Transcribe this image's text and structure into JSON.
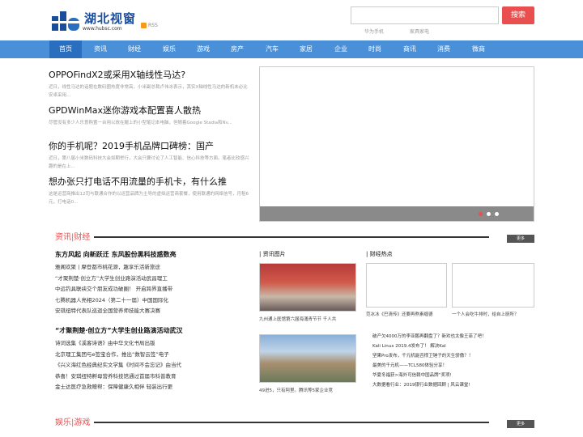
{
  "header": {
    "logo_text": "湖北视窗",
    "logo_url": "www.hubsc.com",
    "rss_label": "RSS",
    "search_placeholder": "",
    "search_button": "搜索",
    "hotwords": [
      "华为手机",
      "家具家电"
    ]
  },
  "nav": {
    "items": [
      "首页",
      "资讯",
      "财经",
      "娱乐",
      "游戏",
      "房产",
      "汽车",
      "家居",
      "企业",
      "时尚",
      "商讯",
      "消费",
      "微商"
    ],
    "active_index": 0
  },
  "headlines": [
    {
      "title": "OPPOFindX2或采用X轴线性马达?",
      "desc": "近日，线性马达的话题在数码圈热度非常高，小米副总裁卢伟冰表示，其实X轴线性马达的新机未必比安卓采用..."
    },
    {
      "title": "GPDWinMax迷你游戏本配置喜人散热",
      "desc": "尽管没有多少人乐意购置一台用以放在腿上的小型笔记本电脑，但随着Google Stadia和Nv..."
    },
    {
      "title": "你的手机呢？2019手机品牌口碑榜：国产",
      "desc": "近日，第八届小米数码科技大会如期举行，大会只要讨论了人工智能、信心科技等方面。笔者比较感兴趣的是在上..."
    },
    {
      "title": "想办张只打电话不用流量的手机卡，有什么推",
      "desc": "这是运营商推出12司与联通合作的以运营品牌为主导的虚拟运营商套餐，使用联通的网络信号，月租6元，打电话0..."
    }
  ],
  "slider": {
    "dots": 3,
    "active_dot": 0
  },
  "finance": {
    "section_title": "资讯|财经",
    "more_label": "更多",
    "lead1": "东方风起 向新跃迁 东风股份黑科技惑数亮",
    "list1": [
      "雅阁欢聚 | 摩登都市桃花源，趣享乐活新旅途",
      "“才聚荆楚·创立方”大学生创业路演活动武昌理工",
      "中远钓具联袂交个朋友成功破圈！ 开启跨界直播带",
      "七腾机器人亮相2024（第二十一届）中国国际化",
      "安琪纽特代表队巡迴全国营养师技能大赛决赛"
    ],
    "lead2": "“才聚荆楚·创立方”大学生创业路演活动武汉",
    "list2": [
      "诗词选集《溪客诗语》由中华文化书局出版",
      "北京理工集团与e签宝合作，推出“数智云签”电子",
      "《兴义海红色经典纪实文学集《时间不会忘记》由当代",
      "恭喜！安琪纽特孵母营养科技馆通过首届市科普教育",
      "金士达医疗急救赠帮：保障健康久相伴 轻装出行更"
    ],
    "pics_title": "| 资讯图片",
    "pic_captions": [
      "九州通上医馆第六届海涌青节节 千人共",
      "49进5，只有阿里。腾讯等5家企业竞"
    ],
    "hot_title": "| 财经热点",
    "hot_pic_captions": [
      "范冰冰《巴清传》还要再熬素缠德",
      "一个人会吃牛排时，给自上厨所？"
    ],
    "hot_list": [
      "破产欠4000万的李亚鹏再翻盘了？新欢也太像王菲了吧！",
      "Kali Linux 2019.4发布了！ 解决Kal",
      "坚果Pro发布，千元机能否撑卫锤子的天生骄傲？！",
      "最美的千元机——TCL580体验分享！",
      "华夏冬福获>海外可信赖中国品牌“奖项!",
      "大数据看行业：2019银行业数据回顾 | 风云课堂!"
    ]
  },
  "entertainment": {
    "section_title": "娱乐|游戏",
    "more_label": "更多"
  },
  "colors": {
    "accent": "#e94f4f",
    "nav": "#4a90d9",
    "nav_active": "#2a6fbf"
  }
}
